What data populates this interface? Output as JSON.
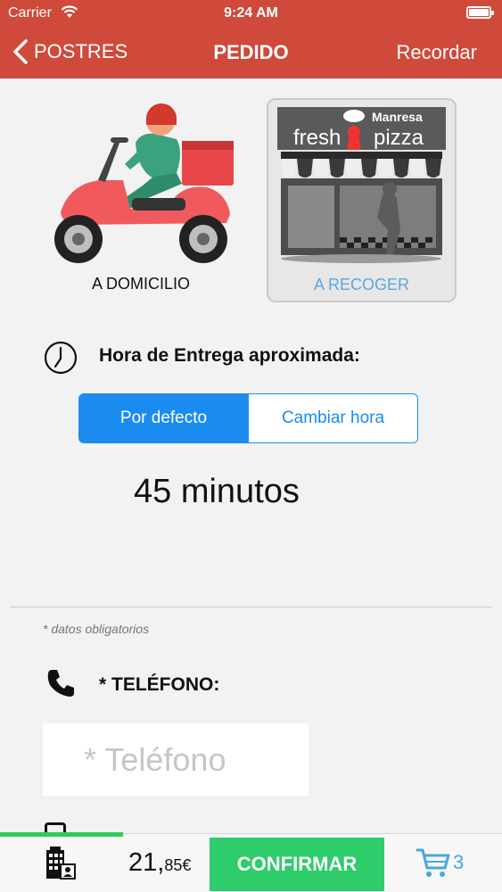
{
  "status_bar": {
    "carrier": "Carrier",
    "time": "9:24 AM"
  },
  "nav": {
    "back_label": "POSTRES",
    "title": "PEDIDO",
    "right_label": "Recordar"
  },
  "delivery_options": {
    "home": {
      "label": "A DOMICILIO",
      "icon": "scooter-rider-icon"
    },
    "pickup": {
      "label": "A RECOGER",
      "icon": "pizza-shop-icon",
      "shop_name_top": "Manresa",
      "shop_name_left": "fresh",
      "shop_name_right": "pizza"
    }
  },
  "delivery_time": {
    "label": "Hora de Entrega aproximada:",
    "segments": [
      "Por defecto",
      "Cambiar hora"
    ],
    "selected_segment": "Por defecto",
    "value": "45 minutos"
  },
  "form": {
    "required_note": "* datos obligatorios",
    "phone_label": "* TELÉFONO:",
    "phone_placeholder": "* Teléfono",
    "phone_value": ""
  },
  "footer": {
    "total_main": "21,",
    "total_cents": "85€",
    "confirm_label": "CONFIRMAR",
    "cart_count": "3",
    "progress_fraction": 0.245
  },
  "colors": {
    "nav_bg": "#cf4a3a",
    "accent_blue": "#1a8cf0",
    "confirm_green": "#2ecc6a",
    "link_blue": "#5aa8e0"
  }
}
